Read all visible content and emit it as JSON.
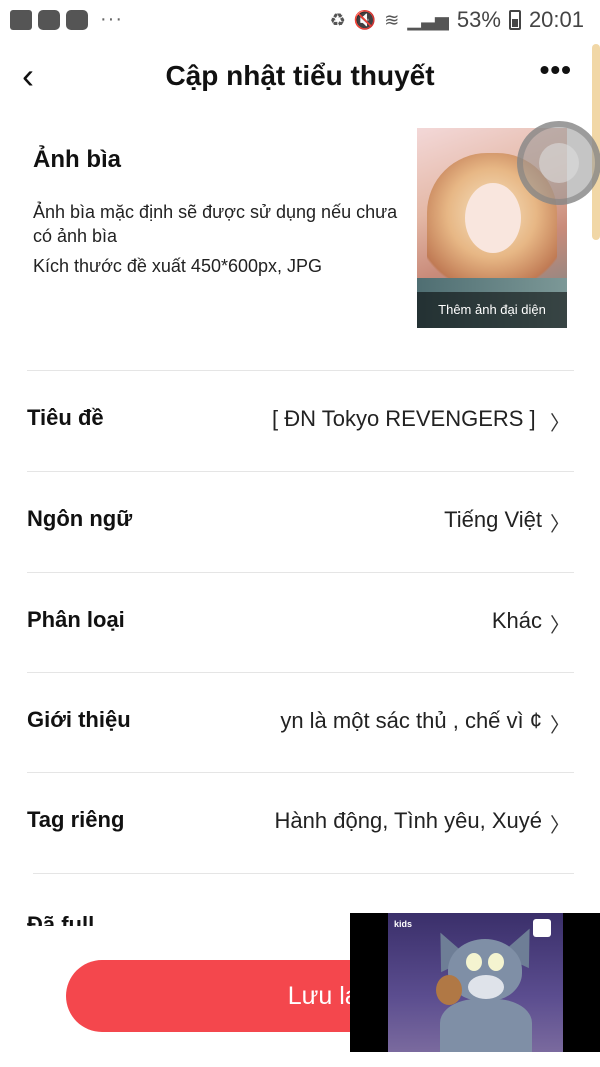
{
  "status_bar": {
    "battery": "53%",
    "time": "20:01",
    "overflow": "···",
    "icons": [
      "gallery-icon",
      "screen-recorder-icon",
      "youtube-icon",
      "recycle-icon",
      "mute-icon",
      "wifi-icon",
      "signal-icon",
      "battery-icon"
    ]
  },
  "header": {
    "title": "Cập nhật tiểu thuyết",
    "back_icon": "‹",
    "more_icon": "•••"
  },
  "cover": {
    "title": "Ảnh bìa",
    "description": "Ảnh bìa mặc định sẽ được sử dụng nếu chưa có ảnh bìa",
    "size_hint": "Kích thước đề xuất 450*600px, JPG",
    "add_label": "Thêm ảnh đại diện"
  },
  "rows": [
    {
      "label": "Tiêu đề",
      "value": "[ ĐN Tokyo REVENGERS ] ·"
    },
    {
      "label": "Ngôn ngữ",
      "value": "Tiếng Việt"
    },
    {
      "label": "Phân loại",
      "value": "Khác"
    },
    {
      "label": "Giới thiệu",
      "value": "yn là một sác thủ , chế vì ¢"
    },
    {
      "label": "Tag riêng",
      "value": "Hành động, Tình yêu, Xuyé"
    }
  ],
  "partial_row_label": "Đã full",
  "save_button": {
    "label": "Lưu lại"
  },
  "pip": {
    "logo": "kids",
    "colors": {
      "accent": "#f4474d"
    }
  }
}
